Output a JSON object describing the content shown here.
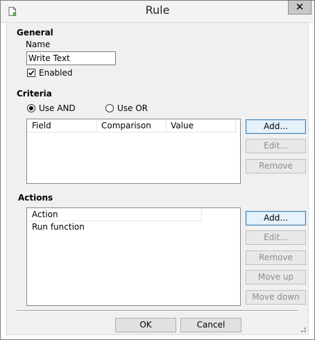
{
  "window": {
    "title": "Rule",
    "close_glyph": "✕"
  },
  "general": {
    "heading": "General",
    "name_label": "Name",
    "name_value": "Write Text",
    "enabled_label": "Enabled",
    "enabled_checked": true
  },
  "criteria": {
    "heading": "Criteria",
    "use_and_label": "Use AND",
    "use_or_label": "Use OR",
    "selected": "and",
    "columns": [
      "Field",
      "Comparison",
      "Value"
    ],
    "rows": [],
    "add_label": "Add...",
    "edit_label": "Edit...",
    "remove_label": "Remove"
  },
  "actions": {
    "heading": "Actions",
    "columns": [
      "Action"
    ],
    "rows": [
      "Run function"
    ],
    "add_label": "Add...",
    "edit_label": "Edit...",
    "remove_label": "Remove",
    "move_up_label": "Move up",
    "move_down_label": "Move down"
  },
  "footer": {
    "ok_label": "OK",
    "cancel_label": "Cancel"
  },
  "colors": {
    "accent_border": "#3c7fb1",
    "disabled_text": "#8d8d8d",
    "client_bg": "#f0f0f0"
  },
  "icons": {
    "app": "document-rule-icon",
    "check": "checkmark-icon"
  }
}
